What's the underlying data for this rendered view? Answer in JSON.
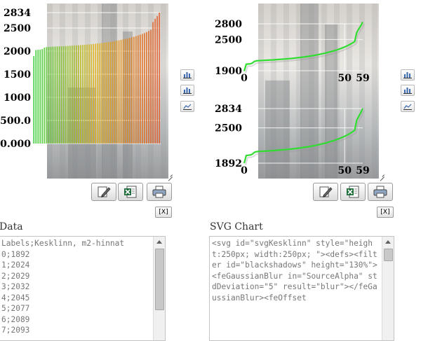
{
  "left_chart": {
    "y_ticks": [
      "2834",
      "2500",
      "2000",
      "1500",
      "1000",
      "500.0",
      "0.000"
    ]
  },
  "right_top_chart": {
    "y_ticks": [
      "2800",
      "2500",
      "1900"
    ],
    "x_ticks": [
      "0",
      "50",
      "59"
    ]
  },
  "right_bottom_chart": {
    "y_ticks": [
      "2834",
      "2500",
      "1892"
    ],
    "x_ticks": [
      "0",
      "50",
      "59"
    ]
  },
  "chart_data": [
    {
      "type": "bar",
      "y_range": [
        0,
        2834
      ],
      "grid": true,
      "colors": [
        "#33cc33",
        "#e2b21a",
        "#e05a2a"
      ],
      "values": [
        1892,
        2024,
        2029,
        2032,
        2045,
        2077,
        2089,
        2093,
        2095,
        2097,
        2099,
        2101,
        2103,
        2105,
        2107,
        2110,
        2113,
        2116,
        2119,
        2122,
        2125,
        2128,
        2131,
        2134,
        2138,
        2142,
        2146,
        2150,
        2155,
        2160,
        2165,
        2170,
        2176,
        2182,
        2188,
        2195,
        2202,
        2210,
        2218,
        2226,
        2235,
        2244,
        2254,
        2264,
        2275,
        2286,
        2298,
        2311,
        2325,
        2340,
        2356,
        2373,
        2391,
        2412,
        2435,
        2460,
        2630,
        2700,
        2760,
        2834
      ]
    },
    {
      "type": "line",
      "y_range": [
        1900,
        2800
      ],
      "x_range": [
        0,
        59
      ],
      "grid": true,
      "colors": [
        "#2fdc2f"
      ],
      "values": [
        1892,
        2024,
        2029,
        2032,
        2045,
        2077,
        2089,
        2093,
        2095,
        2097,
        2099,
        2101,
        2103,
        2105,
        2107,
        2110,
        2113,
        2116,
        2119,
        2122,
        2125,
        2128,
        2131,
        2134,
        2138,
        2142,
        2146,
        2150,
        2155,
        2160,
        2165,
        2170,
        2176,
        2182,
        2188,
        2195,
        2202,
        2210,
        2218,
        2226,
        2235,
        2244,
        2254,
        2264,
        2275,
        2286,
        2298,
        2311,
        2325,
        2340,
        2356,
        2373,
        2391,
        2412,
        2435,
        2460,
        2630,
        2700,
        2760,
        2834
      ]
    },
    {
      "type": "line",
      "y_range": [
        1892,
        2834
      ],
      "x_range": [
        0,
        59
      ],
      "grid": true,
      "colors": [
        "#2fdc2f"
      ],
      "values": [
        1892,
        2024,
        2029,
        2032,
        2045,
        2077,
        2089,
        2093,
        2095,
        2097,
        2099,
        2101,
        2103,
        2105,
        2107,
        2110,
        2113,
        2116,
        2119,
        2122,
        2125,
        2128,
        2131,
        2134,
        2138,
        2142,
        2146,
        2150,
        2155,
        2160,
        2165,
        2170,
        2176,
        2182,
        2188,
        2195,
        2202,
        2210,
        2218,
        2226,
        2235,
        2244,
        2254,
        2264,
        2275,
        2286,
        2298,
        2311,
        2325,
        2340,
        2356,
        2373,
        2391,
        2412,
        2435,
        2460,
        2630,
        2700,
        2760,
        2834
      ]
    }
  ],
  "side_buttons": [
    {
      "icon": "bar-chart-icon"
    },
    {
      "icon": "bar-chart-icon"
    },
    {
      "icon": "area-chart-icon"
    }
  ],
  "toolbar_icons": [
    "edit-pencil-icon",
    "excel-export-icon",
    "print-icon"
  ],
  "close_label": "[X]",
  "data_panel": {
    "title": "Data",
    "lines": "Labels;Kesklinn, m2-hinnat\n0;1892\n1;2024\n2;2029\n3;2032\n4;2045\n5;2077\n6;2089\n7;2093"
  },
  "svg_panel": {
    "title": "SVG Chart",
    "lines": "<svg id=\"svgKesklinn\" style=\"height:250px; width:250px; \"><defs><filter id=\"blackshadows\" height=\"130%\"><feGaussianBlur in=\"SourceAlpha\" stdDeviation=\"5\" result=\"blur\"></feGaussianBlur><feOffset"
  }
}
